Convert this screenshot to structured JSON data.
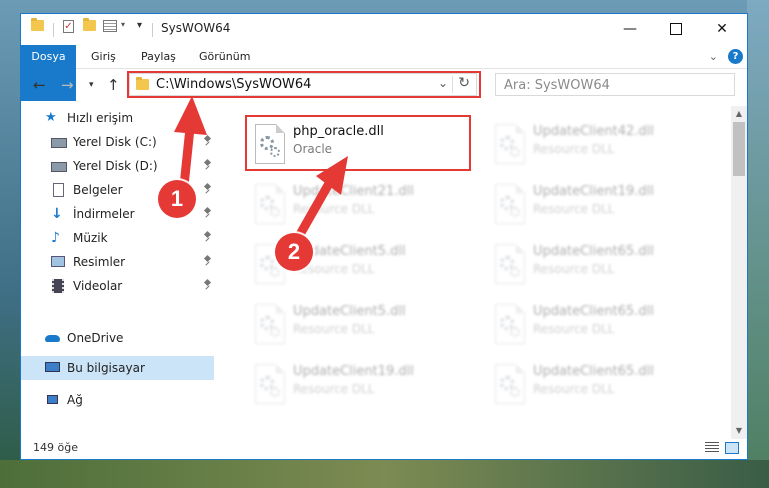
{
  "window": {
    "title": "SysWOW64",
    "controls": [
      "minimize",
      "maximize",
      "close"
    ]
  },
  "ribbon": {
    "tabs": [
      "Dosya",
      "Giriş",
      "Paylaş",
      "Görünüm"
    ]
  },
  "address": {
    "path": "C:\\Windows\\SysWOW64",
    "search_placeholder": "Ara: SysWOW64"
  },
  "sidebar": {
    "items": [
      {
        "label": "Hızlı erişim",
        "icon": "star-icon",
        "pinned": false,
        "selected": false
      },
      {
        "label": "Yerel Disk (C:)",
        "icon": "drive-icon",
        "pinned": true,
        "selected": false
      },
      {
        "label": "Yerel Disk (D:)",
        "icon": "drive-icon",
        "pinned": true,
        "selected": false
      },
      {
        "label": "Belgeler",
        "icon": "documents-icon",
        "pinned": true,
        "selected": false
      },
      {
        "label": "İndirmeler",
        "icon": "download-icon",
        "pinned": true,
        "selected": false
      },
      {
        "label": "Müzik",
        "icon": "music-icon",
        "pinned": true,
        "selected": false
      },
      {
        "label": "Resimler",
        "icon": "pictures-icon",
        "pinned": true,
        "selected": false
      },
      {
        "label": "Videolar",
        "icon": "videos-icon",
        "pinned": true,
        "selected": false
      },
      {
        "label": "OneDrive",
        "icon": "cloud-icon",
        "pinned": false,
        "selected": false
      },
      {
        "label": "Bu bilgisayar",
        "icon": "computer-icon",
        "pinned": false,
        "selected": true
      },
      {
        "label": "Ağ",
        "icon": "network-icon",
        "pinned": false,
        "selected": false
      }
    ]
  },
  "files": [
    {
      "name": "php_oracle.dll",
      "type": "Oracle",
      "highlighted": true
    },
    {
      "name": "UpdateClient42.dll",
      "type": "Resource DLL"
    },
    {
      "name": "UpdateClient21.dll",
      "type": "Resource DLL"
    },
    {
      "name": "UpdateClient19.dll",
      "type": "Resource DLL"
    },
    {
      "name": "UpdateClient5.dll",
      "type": "Resource DLL"
    },
    {
      "name": "UpdateClient65.dll",
      "type": "Resource DLL"
    },
    {
      "name": "UpdateClient5.dll",
      "type": "Resource DLL"
    },
    {
      "name": "UpdateClient65.dll",
      "type": "Resource DLL"
    },
    {
      "name": "UpdateClient19.dll",
      "type": "Resource DLL"
    },
    {
      "name": "UpdateClient65.dll",
      "type": "Resource DLL"
    }
  ],
  "status": {
    "item_count": "149 öğe"
  },
  "annotations": {
    "step1": "1",
    "step2": "2",
    "color": "#e53935"
  },
  "colors": {
    "accent": "#1979ca",
    "selection": "#cce4f7"
  }
}
